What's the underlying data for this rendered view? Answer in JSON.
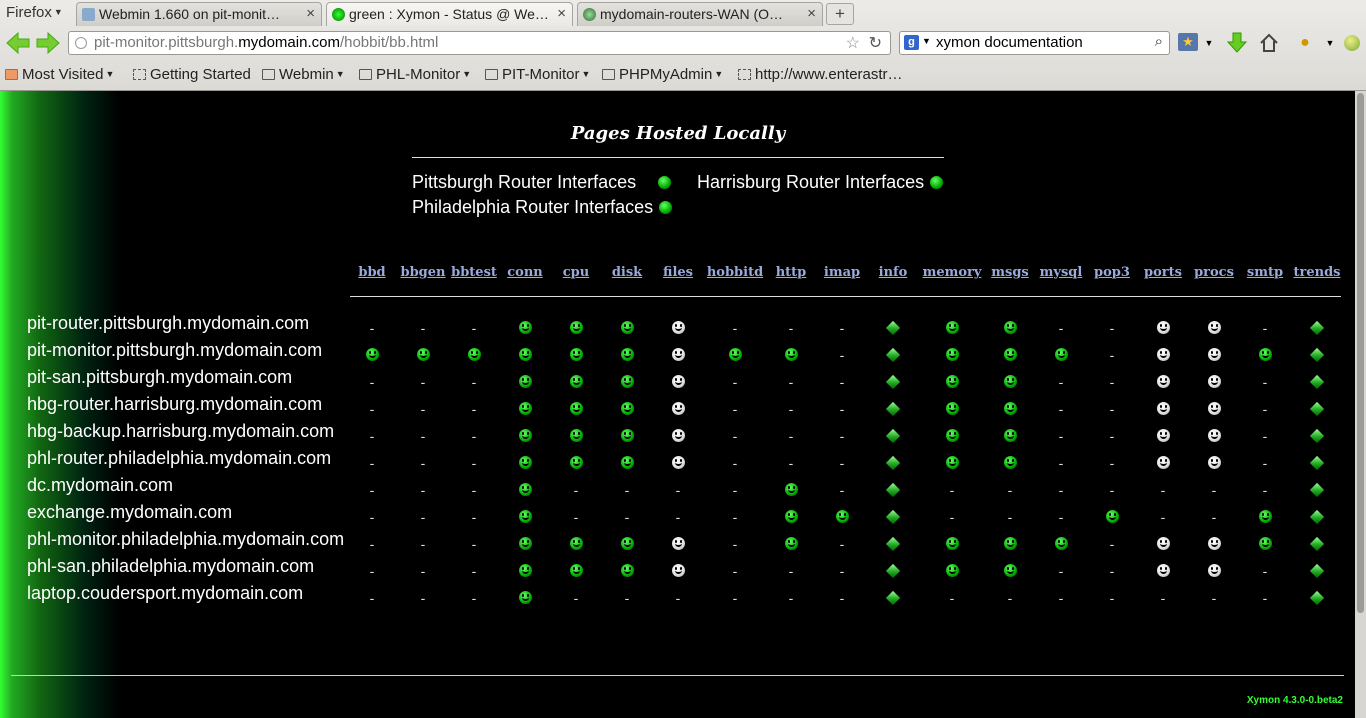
{
  "browser": {
    "app_menu": "Firefox",
    "tabs": [
      {
        "title": "Webmin 1.660 on pit-monit…"
      },
      {
        "title": "green : Xymon - Status @ We…"
      },
      {
        "title": "mydomain-routers-WAN (O…"
      }
    ],
    "new_tab": "+",
    "url_prefix": "pit-monitor.pittsburgh.",
    "url_host": "mydomain.com",
    "url_suffix": "/hobbit/bb.html",
    "search_value": "xymon documentation",
    "bookmarks": [
      "Most Visited",
      "Getting Started",
      "Webmin",
      "PHL-Monitor",
      "PIT-Monitor",
      "PHPMyAdmin",
      "http://www.enterastr…"
    ]
  },
  "page": {
    "hosted_title": "Pages Hosted Locally",
    "hosted_links": [
      "Pittsburgh Router Interfaces",
      "Harrisburg Router Interfaces",
      "Philadelphia Router Interfaces"
    ],
    "columns": [
      "bbd",
      "bbgen",
      "bbtest",
      "conn",
      "cpu",
      "disk",
      "files",
      "hobbitd",
      "http",
      "imap",
      "info",
      "memory",
      "msgs",
      "mysql",
      "pop3",
      "ports",
      "procs",
      "smtp",
      "trends"
    ],
    "hosts": [
      {
        "name": "pit-router.pittsburgh.mydomain.com",
        "status": [
          "-",
          "-",
          "-",
          "g",
          "g",
          "g",
          "c",
          "-",
          "-",
          "-",
          "d",
          "g",
          "g",
          "-",
          "-",
          "c",
          "c",
          "-",
          "d"
        ]
      },
      {
        "name": "pit-monitor.pittsburgh.mydomain.com",
        "status": [
          "g",
          "g",
          "g",
          "g",
          "g",
          "g",
          "c",
          "g",
          "g",
          "-",
          "d",
          "g",
          "g",
          "g",
          "-",
          "c",
          "c",
          "g",
          "d"
        ]
      },
      {
        "name": "pit-san.pittsburgh.mydomain.com",
        "status": [
          "-",
          "-",
          "-",
          "g",
          "g",
          "g",
          "c",
          "-",
          "-",
          "-",
          "d",
          "g",
          "g",
          "-",
          "-",
          "c",
          "c",
          "-",
          "d"
        ]
      },
      {
        "name": "hbg-router.harrisburg.mydomain.com",
        "status": [
          "-",
          "-",
          "-",
          "g",
          "g",
          "g",
          "c",
          "-",
          "-",
          "-",
          "d",
          "g",
          "g",
          "-",
          "-",
          "c",
          "c",
          "-",
          "d"
        ]
      },
      {
        "name": "hbg-backup.harrisburg.mydomain.com",
        "status": [
          "-",
          "-",
          "-",
          "g",
          "g",
          "g",
          "c",
          "-",
          "-",
          "-",
          "d",
          "g",
          "g",
          "-",
          "-",
          "c",
          "c",
          "-",
          "d"
        ]
      },
      {
        "name": "phl-router.philadelphia.mydomain.com",
        "status": [
          "-",
          "-",
          "-",
          "g",
          "g",
          "g",
          "c",
          "-",
          "-",
          "-",
          "d",
          "g",
          "g",
          "-",
          "-",
          "c",
          "c",
          "-",
          "d"
        ]
      },
      {
        "name": "dc.mydomain.com",
        "status": [
          "-",
          "-",
          "-",
          "g",
          "-",
          "-",
          "-",
          "-",
          "g",
          "-",
          "d",
          "-",
          "-",
          "-",
          "-",
          "-",
          "-",
          "-",
          "d"
        ]
      },
      {
        "name": "exchange.mydomain.com",
        "status": [
          "-",
          "-",
          "-",
          "g",
          "-",
          "-",
          "-",
          "-",
          "g",
          "g",
          "d",
          "-",
          "-",
          "-",
          "g",
          "-",
          "-",
          "g",
          "d"
        ]
      },
      {
        "name": "phl-monitor.philadelphia.mydomain.com",
        "status": [
          "-",
          "-",
          "-",
          "g",
          "g",
          "g",
          "c",
          "-",
          "g",
          "-",
          "d",
          "g",
          "g",
          "g",
          "-",
          "c",
          "c",
          "g",
          "d"
        ]
      },
      {
        "name": "phl-san.philadelphia.mydomain.com",
        "status": [
          "-",
          "-",
          "-",
          "g",
          "g",
          "g",
          "c",
          "-",
          "-",
          "-",
          "d",
          "g",
          "g",
          "-",
          "-",
          "c",
          "c",
          "-",
          "d"
        ]
      },
      {
        "name": "laptop.coudersport.mydomain.com",
        "status": [
          "-",
          "-",
          "-",
          "g",
          "-",
          "-",
          "-",
          "-",
          "-",
          "-",
          "d",
          "-",
          "-",
          "-",
          "-",
          "-",
          "-",
          "-",
          "d"
        ]
      }
    ],
    "footer_version": "Xymon 4.3.0-0.beta2"
  }
}
